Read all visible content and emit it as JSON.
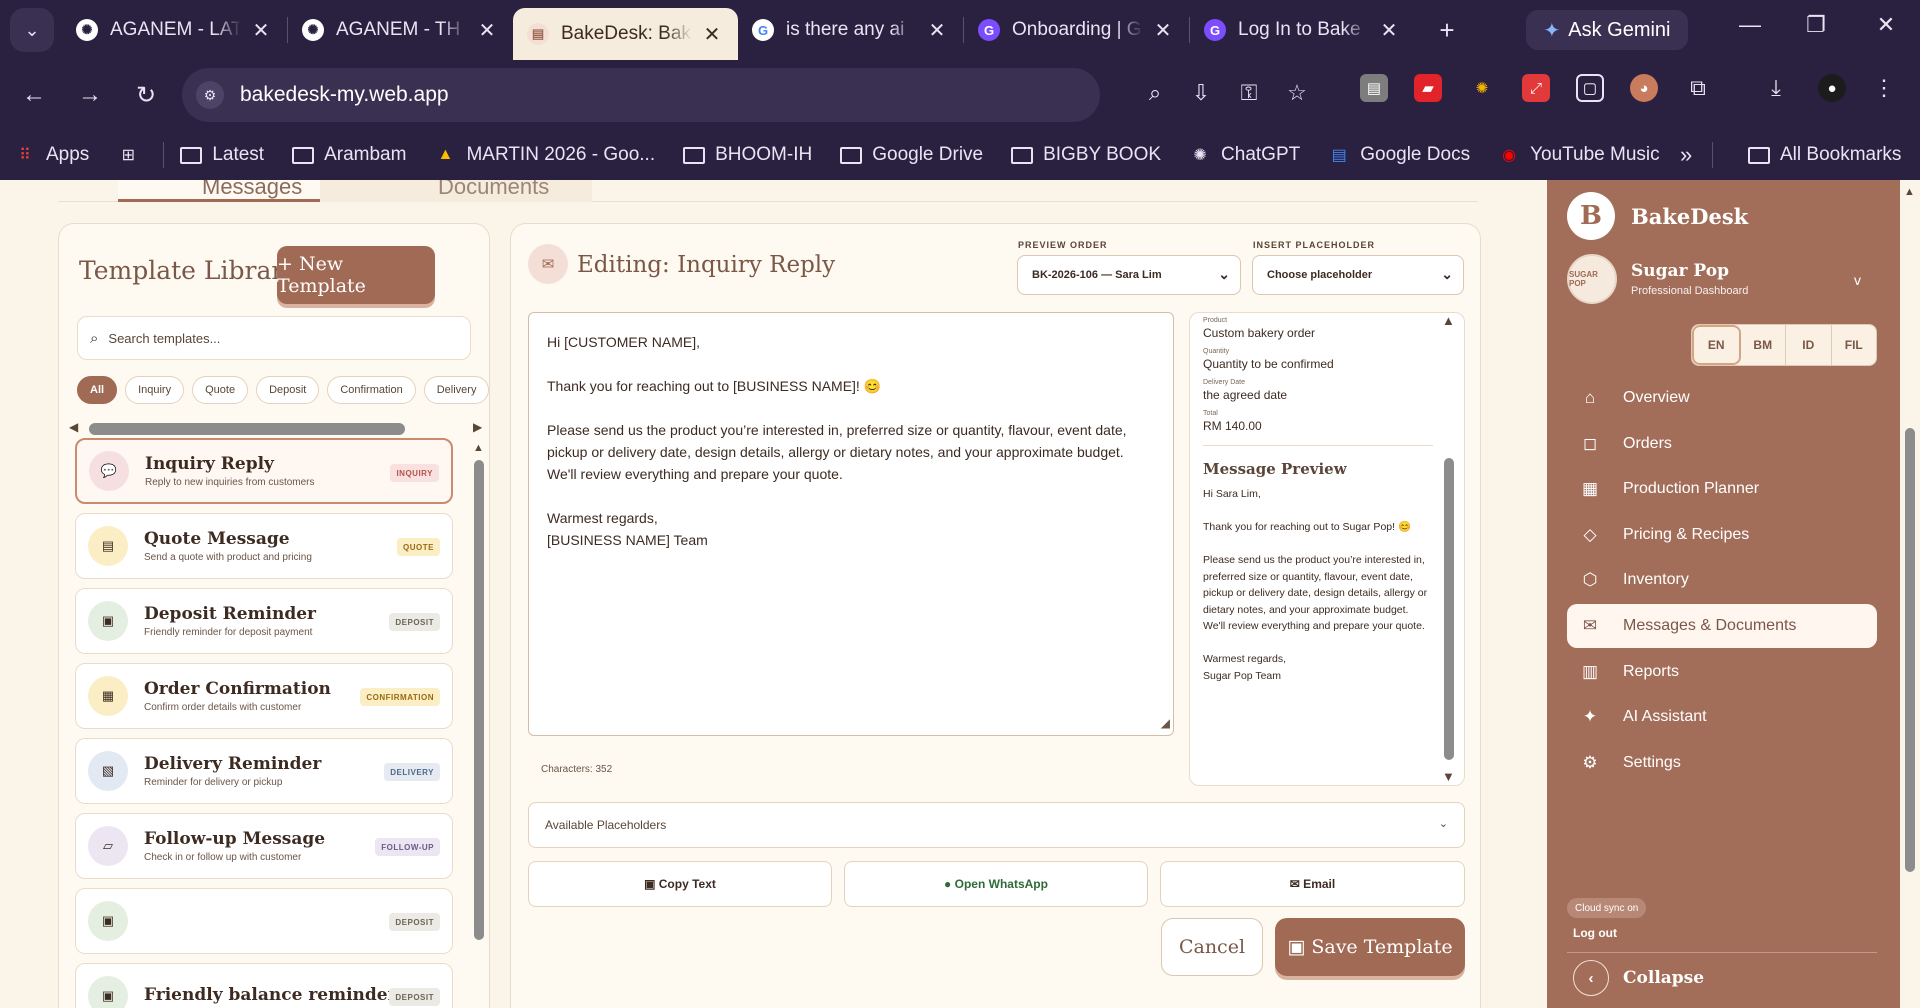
{
  "browser": {
    "tabs": [
      {
        "title": "AGANEM - LAT",
        "fav": "✺",
        "fav_bg": "#ffffff",
        "fav_fg": "#2a2140",
        "active": false
      },
      {
        "title": "AGANEM - TH",
        "fav": "✺",
        "fav_bg": "#ffffff",
        "fav_fg": "#2a2140",
        "active": false
      },
      {
        "title": "BakeDesk: Bak",
        "fav": "▤",
        "fav_bg": "#f3dfd5",
        "fav_fg": "#a06a55",
        "active": true
      },
      {
        "title": "is there any ai",
        "fav": "G",
        "fav_bg": "#ffffff",
        "fav_fg": "#4285f4",
        "active": false
      },
      {
        "title": "Onboarding | G",
        "fav": "G",
        "fav_bg": "#7c4dff",
        "fav_fg": "#ffffff",
        "active": false
      },
      {
        "title": "Log In to Bake",
        "fav": "G",
        "fav_bg": "#7c4dff",
        "fav_fg": "#ffffff",
        "active": false
      }
    ],
    "new_tab": "+",
    "gemini_label": "Ask Gemini",
    "url": "bakedesk-my.web.app",
    "bookmarks": [
      {
        "label": "Apps",
        "icon": "apps-icon"
      },
      {
        "label": "",
        "icon": "grid-icon"
      },
      {
        "label": "Latest",
        "icon": "folder-icon"
      },
      {
        "label": "Arambam",
        "icon": "folder-icon"
      },
      {
        "label": "MARTIN 2026 - Goo...",
        "icon": "drive-icon"
      },
      {
        "label": "BHOOM-IH",
        "icon": "folder-icon"
      },
      {
        "label": "Google Drive",
        "icon": "folder-icon"
      },
      {
        "label": "BIGBY BOOK",
        "icon": "folder-icon"
      },
      {
        "label": "ChatGPT",
        "icon": "chatgpt-icon"
      },
      {
        "label": "Google Docs",
        "icon": "docs-icon"
      },
      {
        "label": "YouTube Music",
        "icon": "youtube-music-icon"
      }
    ],
    "more": "»",
    "all_bookmarks": "All Bookmarks"
  },
  "page_tabs": {
    "messages": "Messages",
    "documents": "Documents"
  },
  "library": {
    "title": "Template Library",
    "new_button": "+ New Template",
    "search_placeholder": "Search templates...",
    "filters": [
      "All",
      "Inquiry",
      "Quote",
      "Deposit",
      "Confirmation",
      "Delivery"
    ],
    "active_filter": "All",
    "templates": [
      {
        "name": "Inquiry Reply",
        "desc": "Reply to new inquiries from customers",
        "badge": "INQUIRY",
        "icon": "speech-bubble-icon",
        "glyph": "💬",
        "icon_bg": "#f6dfe0",
        "badge_bg": "#f9e1e0",
        "badge_fg": "#b4524b",
        "selected": true
      },
      {
        "name": "Quote Message",
        "desc": "Send a quote with product and pricing",
        "badge": "QUOTE",
        "icon": "receipt-icon",
        "glyph": "▤",
        "icon_bg": "#fbeec5",
        "badge_bg": "#fbeec5",
        "badge_fg": "#9a6a10",
        "selected": false
      },
      {
        "name": "Deposit Reminder",
        "desc": "Friendly reminder for deposit payment",
        "badge": "DEPOSIT",
        "icon": "money-icon",
        "glyph": "▣",
        "icon_bg": "#e4efe2",
        "badge_bg": "#eceae4",
        "badge_fg": "#6a6558",
        "selected": false
      },
      {
        "name": "Order Confirmation",
        "desc": "Confirm order details with customer",
        "badge": "CONFIRMATION",
        "icon": "document-icon",
        "glyph": "▦",
        "icon_bg": "#fbeec5",
        "badge_bg": "#fbeec5",
        "badge_fg": "#9a6a10",
        "selected": false
      },
      {
        "name": "Delivery Reminder",
        "desc": "Reminder for delivery or pickup",
        "badge": "DELIVERY",
        "icon": "box-icon",
        "glyph": "▧",
        "icon_bg": "#e2e9f3",
        "badge_bg": "#e6ebf1",
        "badge_fg": "#4e6a8a",
        "selected": false
      },
      {
        "name": "Follow-up Message",
        "desc": "Check in or follow up with customer",
        "badge": "FOLLOW-UP",
        "icon": "envelope-icon",
        "glyph": "▱",
        "icon_bg": "#ebe6f2",
        "badge_bg": "#ebe6f2",
        "badge_fg": "#6a5a8a",
        "selected": false
      },
      {
        "name": "",
        "desc": "",
        "badge": "DEPOSIT",
        "icon": "money-icon",
        "glyph": "▣",
        "icon_bg": "#e4efe2",
        "badge_bg": "#eceae4",
        "badge_fg": "#6a6558",
        "selected": false
      },
      {
        "name": "Friendly balance reminder",
        "desc": "",
        "badge": "DEPOSIT",
        "icon": "money-icon",
        "glyph": "▣",
        "icon_bg": "#e4efe2",
        "badge_bg": "#eceae4",
        "badge_fg": "#6a6558",
        "selected": false
      }
    ]
  },
  "editor": {
    "title": "Editing: Inquiry Reply",
    "preview_order_label": "PREVIEW ORDER",
    "preview_order_value": "BK-2026-106 — Sara Lim",
    "insert_placeholder_label": "INSERT PLACEHOLDER",
    "insert_placeholder_value": "Choose placeholder",
    "message": "Hi [CUSTOMER NAME],\n\nThank you for reaching out to [BUSINESS NAME]! 😊\n\nPlease send us the product you’re interested in, preferred size or quantity, flavour, event date,\npickup or delivery date, design details, allergy or dietary notes, and your approximate budget.\nWe'll review everything and prepare your quote.\n\nWarmest regards,\n[BUSINESS NAME] Team",
    "characters": "Characters: 352",
    "preview_fields": [
      {
        "label": "Product",
        "value": "Custom bakery order"
      },
      {
        "label": "Quantity",
        "value": "Quantity to be confirmed"
      },
      {
        "label": "Delivery Date",
        "value": "the agreed date"
      },
      {
        "label": "Total",
        "value": "RM 140.00"
      }
    ],
    "message_preview_title": "Message Preview",
    "message_preview": "Hi Sara Lim,\n\nThank you for reaching out to Sugar Pop! 😊\n\nPlease send us the product you’re interested in, preferred size or quantity, flavour, event date, pickup or delivery date, design details, allergy or dietary notes, and your approximate budget.\nWe'll review everything and prepare your quote.\n\nWarmest regards,\nSugar Pop Team",
    "available_placeholders": "Available Placeholders",
    "copy_text": "▣ Copy Text",
    "open_whatsapp": "● Open WhatsApp",
    "email": "✉ Email",
    "cancel": "Cancel",
    "save": "▣ Save Template"
  },
  "sidebar": {
    "brand_letter": "B",
    "brand": "BakeDesk",
    "account_name": "Sugar Pop",
    "account_role": "Professional Dashboard",
    "avatar_text": "SUGAR POP",
    "langs": [
      "EN",
      "BM",
      "ID",
      "FIL"
    ],
    "active_lang": "EN",
    "nav": [
      {
        "label": "Overview",
        "icon": "home-icon",
        "glyph": "⌂"
      },
      {
        "label": "Orders",
        "icon": "shopping-bag-icon",
        "glyph": "◻"
      },
      {
        "label": "Production Planner",
        "icon": "calendar-icon",
        "glyph": "▦"
      },
      {
        "label": "Pricing & Recipes",
        "icon": "tag-icon",
        "glyph": "◇"
      },
      {
        "label": "Inventory",
        "icon": "box-icon",
        "glyph": "⬡"
      },
      {
        "label": "Messages & Documents",
        "icon": "mail-icon",
        "glyph": "✉"
      },
      {
        "label": "Reports",
        "icon": "bar-chart-icon",
        "glyph": "▥"
      },
      {
        "label": "AI Assistant",
        "icon": "sparkle-icon",
        "glyph": "✦"
      },
      {
        "label": "Settings",
        "icon": "gear-icon",
        "glyph": "⚙"
      }
    ],
    "active_nav": "Messages & Documents",
    "sync": "Cloud sync on",
    "logout": "Log out",
    "collapse": "Collapse"
  }
}
